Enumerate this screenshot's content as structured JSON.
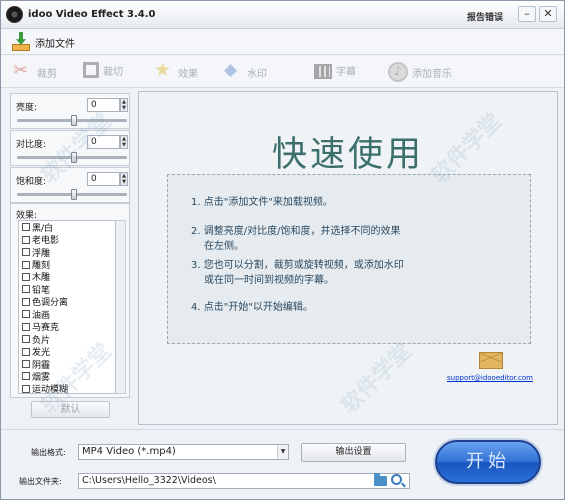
{
  "window": {
    "title": "idoo Video Effect 3.4.0",
    "report_link": "报告错误",
    "minimize": "–",
    "close": "✕"
  },
  "toolbar": {
    "add_file": "添加文件",
    "tools": [
      "裁剪",
      "裁切",
      "效果",
      "水印",
      "字幕",
      "添加音乐"
    ]
  },
  "adjustments": [
    {
      "label": "亮度:",
      "value": "0",
      "level": 0.55
    },
    {
      "label": "对比度:",
      "value": "0",
      "level": 0.55
    },
    {
      "label": "饱和度:",
      "value": "0",
      "level": 0.55
    }
  ],
  "effects": {
    "title": "效果:",
    "items": [
      "黑/白",
      "老电影",
      "浮雕",
      "雕刻",
      "木雕",
      "铅笔",
      "色调分离",
      "油画",
      "马赛克",
      "负片",
      "发光",
      "阴霾",
      "烟雾",
      "运动模糊"
    ],
    "default_button": "默认"
  },
  "main": {
    "title": "快速使用",
    "steps": [
      "1. 点击\"添加文件\"来加载视频。",
      "2. 调整亮度/对比度/饱和度，并选择不同的效果",
      "在左侧。",
      "3. 您也可以分割，裁剪或旋转视频，或添加水印",
      "或在同一时间到视频的字幕。",
      "4. 点击\"开始\"以开始编辑。"
    ],
    "support_email": "support@idooeditor.com"
  },
  "output": {
    "format_label": "输出格式:",
    "format_value": "MP4 Video (*.mp4)",
    "settings_button": "输出设置",
    "folder_label": "输出文件夹:",
    "folder_value": "C:\\Users\\Hello_3322\\Videos\\",
    "start_button": "开始"
  },
  "colors": {
    "title_accent": "#3c6f6c",
    "start_button": "#2f6fd6",
    "link": "#0033cc"
  }
}
